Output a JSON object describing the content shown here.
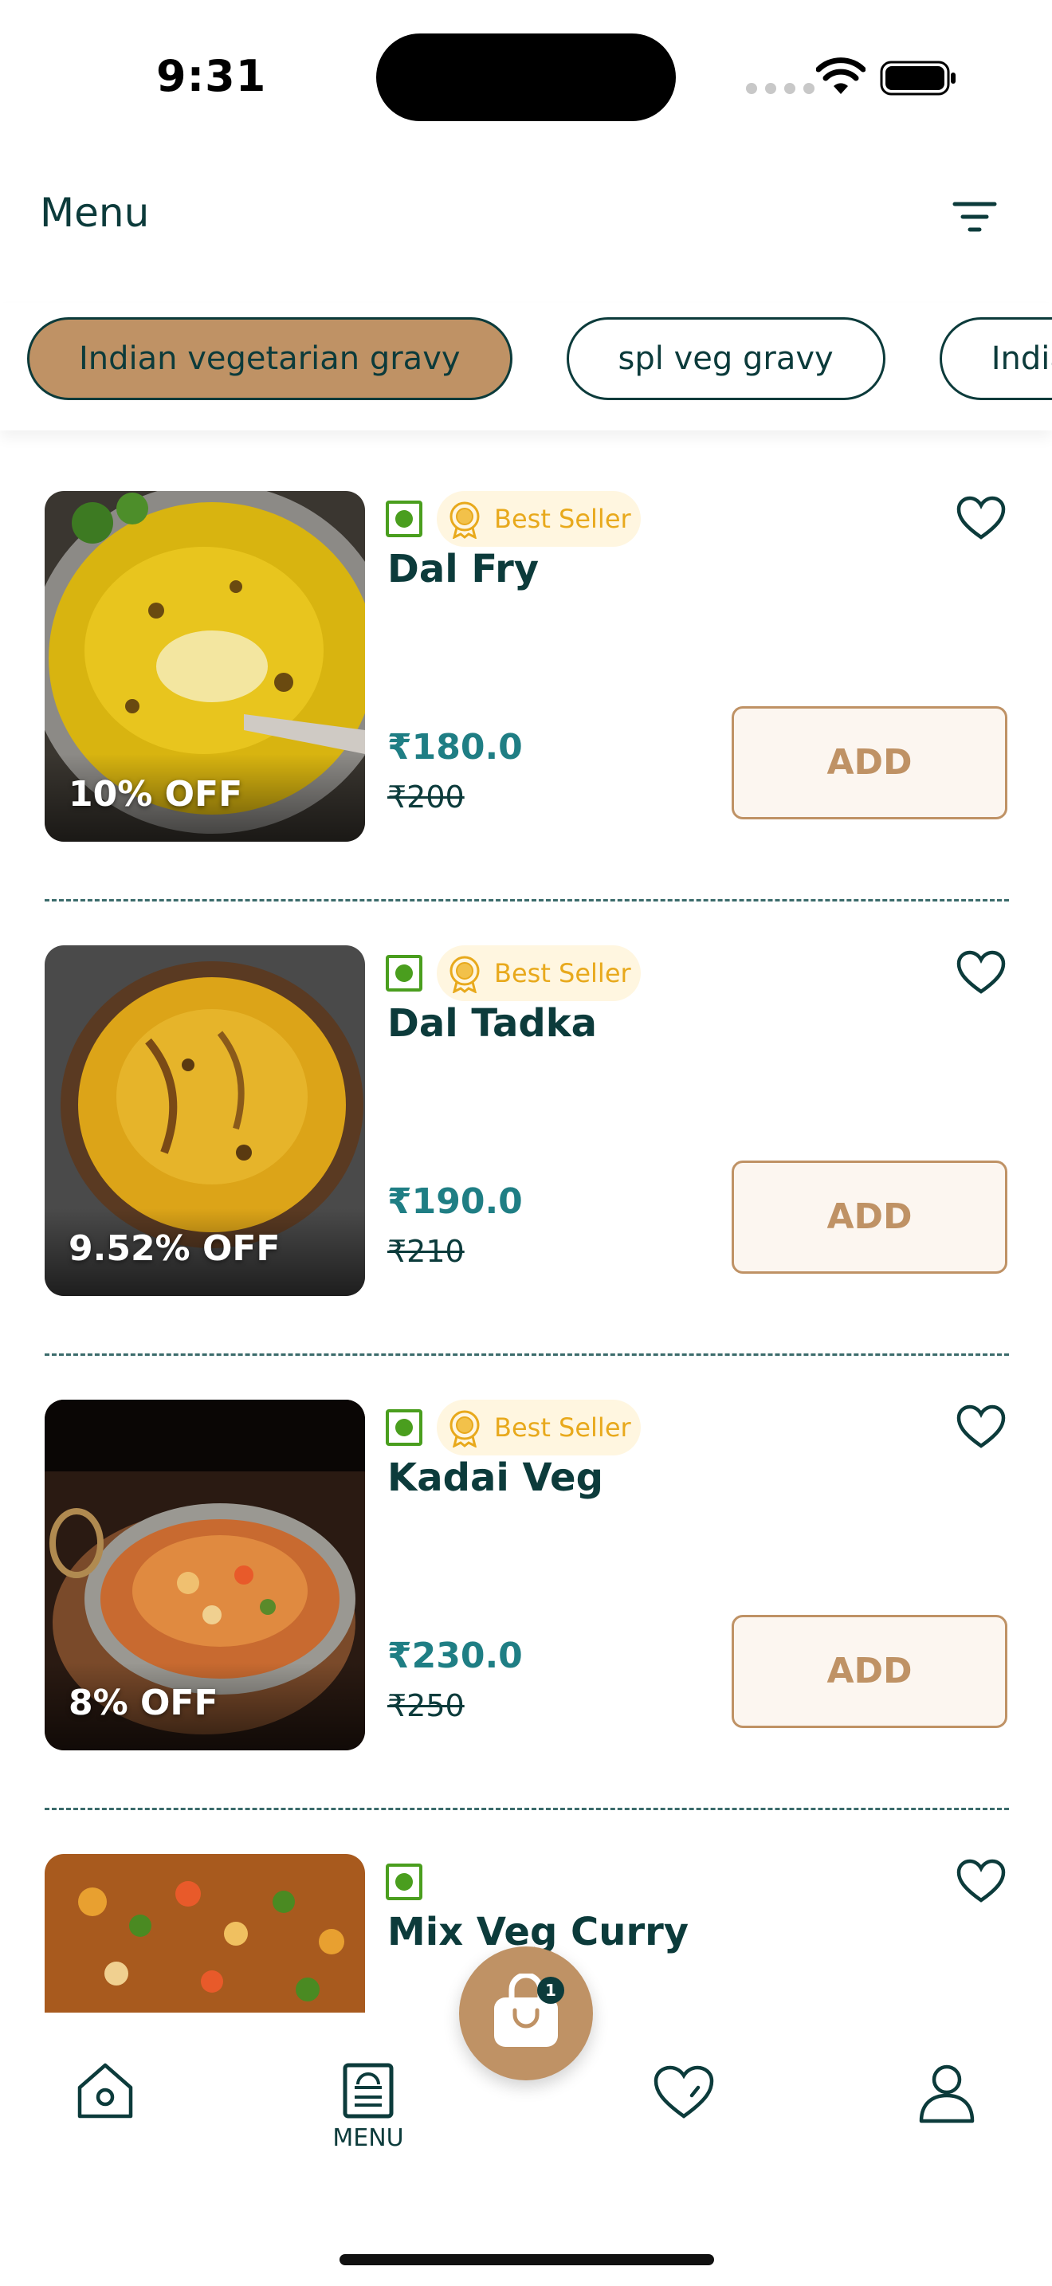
{
  "status_bar": {
    "time": "9:31"
  },
  "header": {
    "title": "Menu"
  },
  "categories": [
    {
      "label": "Indian vegetarian gravy",
      "active": true
    },
    {
      "label": "spl veg gravy",
      "active": false
    },
    {
      "label": "Indian",
      "active": false
    }
  ],
  "items": [
    {
      "name": "Dal Fry",
      "price": "₹180.0",
      "mrp": "₹200",
      "discount": "10% OFF",
      "badge": "Best Seller",
      "add_label": "ADD"
    },
    {
      "name": "Dal Tadka",
      "price": "₹190.0",
      "mrp": "₹210",
      "discount": "9.52% OFF",
      "badge": "Best Seller",
      "add_label": "ADD"
    },
    {
      "name": "Kadai Veg",
      "price": "₹230.0",
      "mrp": "₹250",
      "discount": "8% OFF",
      "badge": "Best Seller",
      "add_label": "ADD"
    },
    {
      "name": "Mix Veg Curry",
      "price": "",
      "mrp": "",
      "discount": "",
      "badge": "",
      "add_label": ""
    }
  ],
  "cart": {
    "count": "1"
  },
  "nav": {
    "menu_label": "MENU"
  },
  "colors": {
    "primary": "#bf9265",
    "text": "#0c3b3b",
    "price": "#1f7e84",
    "veg": "#4a9e1e",
    "badge": "#e8a91c"
  }
}
